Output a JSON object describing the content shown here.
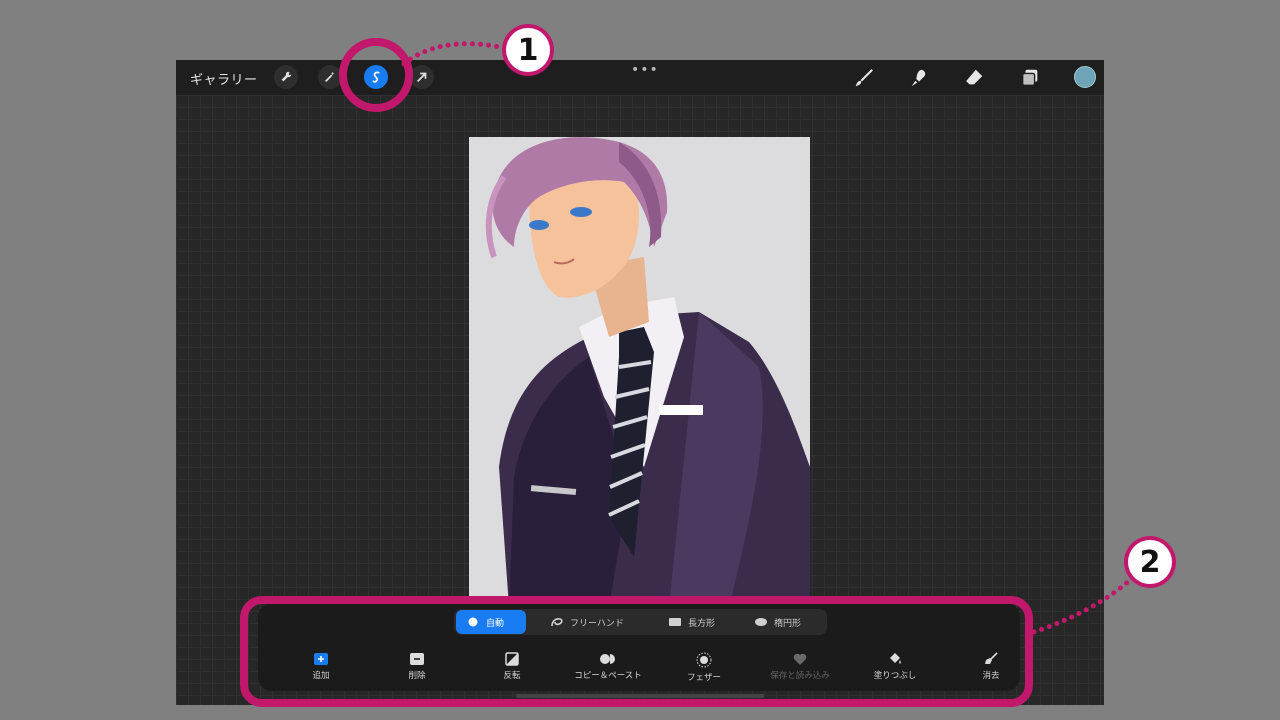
{
  "topbar": {
    "gallery_label": "ギャラリー",
    "more_label": "•••",
    "tools_left": [
      "wrench-icon",
      "magic-wand-icon",
      "selection-icon",
      "transform-arrow-icon"
    ],
    "tools_right": [
      "brush-icon",
      "smudge-icon",
      "eraser-icon",
      "layers-icon"
    ],
    "current_color": "#6fa3b8"
  },
  "selection_panel": {
    "modes": [
      {
        "label": "自動",
        "icon": "auto-sparkle-icon",
        "active": true
      },
      {
        "label": "フリーハンド",
        "icon": "freehand-lasso-icon",
        "active": false
      },
      {
        "label": "長方形",
        "icon": "rectangle-icon",
        "active": false
      },
      {
        "label": "楕円形",
        "icon": "ellipse-icon",
        "active": false
      }
    ],
    "actions": [
      {
        "label": "追加",
        "icon": "plus-icon",
        "enabled": true
      },
      {
        "label": "削除",
        "icon": "minus-icon",
        "enabled": true
      },
      {
        "label": "反転",
        "icon": "invert-icon",
        "enabled": true
      },
      {
        "label": "コピー＆ペースト",
        "icon": "copy-paste-icon",
        "enabled": true
      },
      {
        "label": "フェザー",
        "icon": "feather-icon",
        "enabled": true
      },
      {
        "label": "保存と読み込み",
        "icon": "heart-icon",
        "enabled": false
      },
      {
        "label": "塗りつぶし",
        "icon": "fill-bucket-icon",
        "enabled": true
      },
      {
        "label": "消去",
        "icon": "clear-broom-icon",
        "enabled": true
      }
    ]
  },
  "annotations": {
    "badge_1": "1",
    "badge_2": "2",
    "accent_color": "#c2186b"
  },
  "colors": {
    "accent_blue": "#1a7cf2"
  }
}
